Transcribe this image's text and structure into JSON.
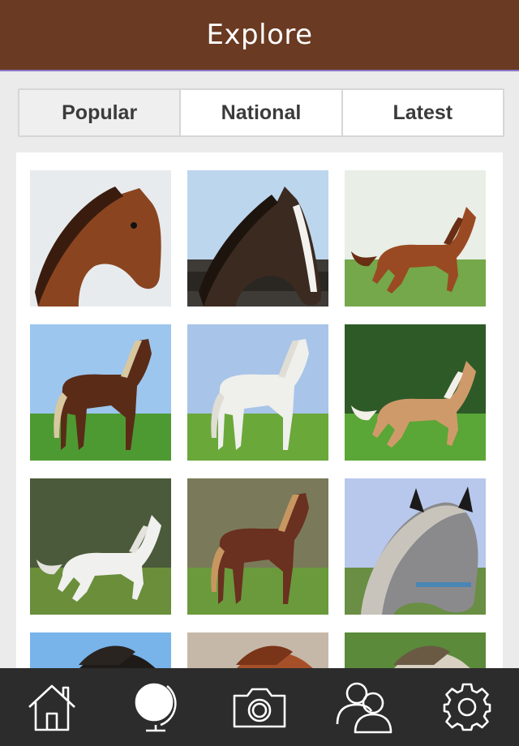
{
  "header": {
    "title": "Explore"
  },
  "segments": [
    {
      "label": "Popular",
      "active": true
    },
    {
      "label": "National",
      "active": false
    },
    {
      "label": "Latest",
      "active": false
    }
  ],
  "photos": [
    {
      "name": "photo-chestnut-head-portrait",
      "sky": "#e8ebee",
      "ground": "#d8d8d8",
      "horse": "#8a4520",
      "mane": "#3a1c0e",
      "pose": "head"
    },
    {
      "name": "photo-dark-bay-blaze-fence",
      "sky": "#bcd6ee",
      "ground": "#3e3a36",
      "horse": "#3b2a20",
      "mane": "#1e140e",
      "pose": "head-blaze"
    },
    {
      "name": "photo-chestnut-galloping-blossom",
      "sky": "#e9eee6",
      "ground": "#74a84a",
      "horse": "#9a4a22",
      "mane": "#6a2e14",
      "pose": "gallop"
    },
    {
      "name": "photo-bay-standing-field",
      "sky": "#9cc6ee",
      "ground": "#4e9a32",
      "horse": "#5a2c18",
      "mane": "#d8c8a0",
      "pose": "stand"
    },
    {
      "name": "photo-white-horse-meadow",
      "sky": "#a8c4e8",
      "ground": "#6aa83a",
      "horse": "#efefec",
      "mane": "#e0ddd5",
      "pose": "stand"
    },
    {
      "name": "photo-palomino-running-grass",
      "sky": "#2e5a28",
      "ground": "#5aa636",
      "horse": "#cf9a6a",
      "mane": "#f2efe8",
      "pose": "gallop"
    },
    {
      "name": "photo-white-horse-rearing-paddock",
      "sky": "#4a5a3a",
      "ground": "#6a8e3a",
      "horse": "#f0f0ee",
      "mane": "#e4e2dc",
      "pose": "gallop"
    },
    {
      "name": "photo-chestnut-flaxen-trotting",
      "sky": "#7a7a5a",
      "ground": "#6a9a3c",
      "horse": "#6a3020",
      "mane": "#c89660",
      "pose": "stand"
    },
    {
      "name": "photo-grey-pony-closeup",
      "sky": "#b8c8ec",
      "ground": "#6a8e44",
      "horse": "#8a8a8c",
      "mane": "#c8c4bc",
      "pose": "head-pony"
    },
    {
      "name": "photo-black-horse-sky",
      "sky": "#78b4ea",
      "ground": "#ffffff",
      "horse": "#1e1a18",
      "mane": "#2a2420",
      "pose": "head-partial"
    },
    {
      "name": "photo-chestnut-forest",
      "sky": "#c6b8a8",
      "ground": "#ffffff",
      "horse": "#a6502a",
      "mane": "#7a3418",
      "pose": "head-partial"
    },
    {
      "name": "photo-appaloosa-field",
      "sky": "#5a8a3a",
      "ground": "#ffffff",
      "horse": "#d8d0c0",
      "mane": "#6a5a44",
      "pose": "head-partial"
    }
  ],
  "tabbar": [
    {
      "name": "home-icon"
    },
    {
      "name": "globe-icon"
    },
    {
      "name": "camera-icon"
    },
    {
      "name": "friends-icon"
    },
    {
      "name": "settings-icon"
    }
  ]
}
